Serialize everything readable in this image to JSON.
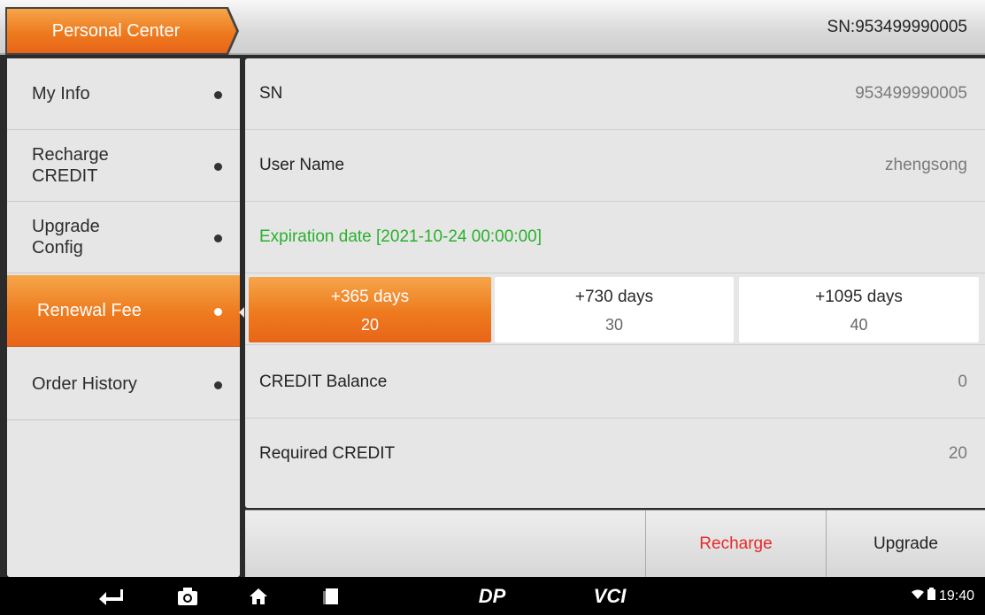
{
  "header": {
    "title": "Personal Center",
    "sn_label": "SN:953499990005"
  },
  "sidebar": {
    "items": [
      {
        "label": "My Info",
        "active": false
      },
      {
        "label": "Recharge CREDIT",
        "active": false
      },
      {
        "label": "Upgrade Config",
        "active": false
      },
      {
        "label": "Renewal Fee",
        "active": true
      },
      {
        "label": "Order History",
        "active": false
      }
    ]
  },
  "info": {
    "sn_key": "SN",
    "sn_value": "953499990005",
    "username_key": "User Name",
    "username_value": "zhengsong",
    "expiration": "Expiration date [2021-10-24 00:00:00]"
  },
  "renewal_options": [
    {
      "days": "+365 days",
      "credit": "20",
      "selected": true
    },
    {
      "days": "+730 days",
      "credit": "30",
      "selected": false
    },
    {
      "days": "+1095 days",
      "credit": "40",
      "selected": false
    }
  ],
  "balance": {
    "credit_balance_key": "CREDIT Balance",
    "credit_balance_value": "0",
    "required_key": "Required CREDIT",
    "required_value": "20"
  },
  "actions": {
    "recharge": "Recharge",
    "upgrade": "Upgrade"
  },
  "navbar": {
    "icons": [
      "back-icon",
      "camera-icon",
      "home-icon",
      "recent-apps-icon",
      "dp-logo-icon",
      "vci-icon"
    ],
    "dp_text": "DP",
    "vci_text": "VCI",
    "time": "19:40"
  },
  "colors": {
    "accent_orange": "#ee7a1e",
    "expiration_green": "#29b12c",
    "recharge_red": "#e52a2a"
  }
}
